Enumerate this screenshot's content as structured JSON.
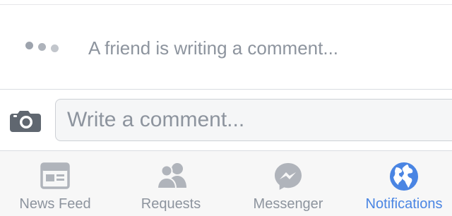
{
  "typing_indicator": {
    "text": "A friend is writing a comment..."
  },
  "composer": {
    "camera_icon": "camera-icon",
    "placeholder": "Write a comment..."
  },
  "tab_bar": {
    "active_color": "#4a85e3",
    "inactive_color": "#8d949e",
    "tabs": [
      {
        "label": "News Feed",
        "icon": "news-feed-icon",
        "active": false
      },
      {
        "label": "Requests",
        "icon": "friend-requests-icon",
        "active": false
      },
      {
        "label": "Messenger",
        "icon": "messenger-icon",
        "active": false
      },
      {
        "label": "Notifications",
        "icon": "globe-icon",
        "active": true
      }
    ]
  }
}
